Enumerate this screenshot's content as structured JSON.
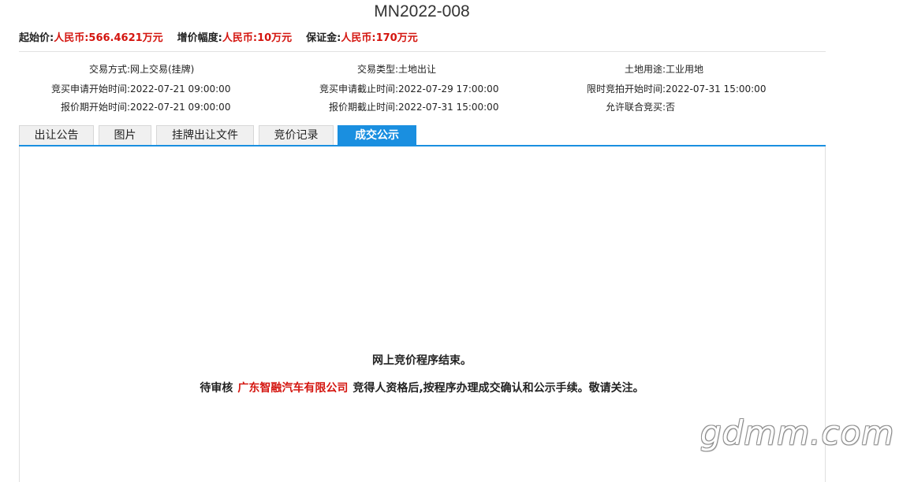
{
  "title": "MN2022-008",
  "price": {
    "start_label": "起始价:",
    "start_value": "人民币:566.4621万元",
    "increment_label": "增价幅度:",
    "increment_value": "人民币:10万元",
    "deposit_label": "保证金:",
    "deposit_value": "人民币:170万元"
  },
  "info": {
    "trade_method_label": "交易方式:",
    "trade_method_value": "网上交易(挂牌)",
    "trade_type_label": "交易类型:",
    "trade_type_value": "土地出让",
    "land_use_label": "土地用途:",
    "land_use_value": "工业用地",
    "apply_start_label": "竞买申请开始时间:",
    "apply_start_value": "2022-07-21 09:00:00",
    "apply_end_label": "竞买申请截止时间:",
    "apply_end_value": "2022-07-29 17:00:00",
    "timed_bid_start_label": "限时竞拍开始时间:",
    "timed_bid_start_value": "2022-07-31 15:00:00",
    "quote_start_label": "报价期开始时间:",
    "quote_start_value": "2022-07-21 09:00:00",
    "quote_end_label": "报价期截止时间:",
    "quote_end_value": "2022-07-31 15:00:00",
    "joint_bid_label": "允许联合竞买:",
    "joint_bid_value": "否"
  },
  "tabs": [
    {
      "label": "出让公告"
    },
    {
      "label": "图片"
    },
    {
      "label": "挂牌出让文件"
    },
    {
      "label": "竞价记录"
    },
    {
      "label": "成交公示"
    }
  ],
  "notice": {
    "line1": "网上竞价程序结束。",
    "line2_prefix": "待审核",
    "company": "广东智融汽车有限公司",
    "line2_suffix": "竞得人资格后,按程序办理成交确认和公示手续。敬请关注。"
  },
  "watermark": "gdmm.com",
  "colors": {
    "accent": "#1a8fe0",
    "highlight_red": "#d4150f"
  }
}
